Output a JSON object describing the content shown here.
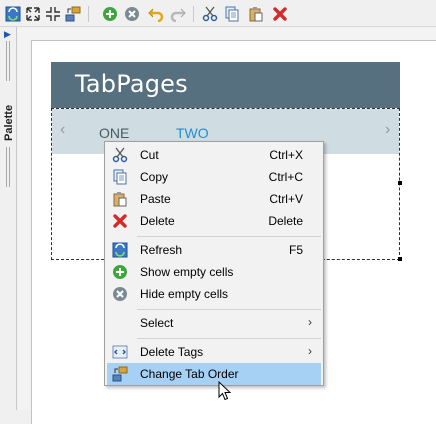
{
  "toolbar": {
    "buttons": [
      {
        "name": "refresh-icon"
      },
      {
        "name": "expand-icon"
      },
      {
        "name": "collapse-icon"
      },
      {
        "name": "change-tab-order-icon"
      },
      {
        "name": "show-empty-cells-icon"
      },
      {
        "name": "hide-empty-cells-icon"
      },
      {
        "name": "undo-icon"
      },
      {
        "name": "redo-icon"
      },
      {
        "name": "cut-icon"
      },
      {
        "name": "copy-icon"
      },
      {
        "name": "paste-icon"
      },
      {
        "name": "delete-icon"
      }
    ]
  },
  "palette": {
    "label": "Palette"
  },
  "widget": {
    "title": "TabPages",
    "tabs": [
      "ONE",
      "TWO"
    ],
    "active_tab": "TWO",
    "prev_arrow": "‹",
    "next_arrow": "›"
  },
  "context_menu": {
    "items": [
      {
        "label": "Cut",
        "shortcut": "Ctrl+X",
        "icon": "cut-icon"
      },
      {
        "label": "Copy",
        "shortcut": "Ctrl+C",
        "icon": "copy-icon"
      },
      {
        "label": "Paste",
        "shortcut": "Ctrl+V",
        "icon": "paste-icon"
      },
      {
        "label": "Delete",
        "shortcut": "Delete",
        "icon": "delete-icon"
      },
      {
        "label": "Refresh",
        "shortcut": "F5",
        "icon": "refresh-icon"
      },
      {
        "label": "Show empty cells",
        "icon": "show-empty-cells-icon"
      },
      {
        "label": "Hide empty cells",
        "icon": "hide-empty-cells-icon"
      },
      {
        "label": "Select",
        "submenu": "›"
      },
      {
        "label": "Delete Tags",
        "submenu": "›",
        "icon": "delete-tags-icon"
      },
      {
        "label": "Change Tab Order",
        "icon": "change-tab-order-icon",
        "selected": true
      }
    ]
  },
  "colors": {
    "header_bg": "#56707f",
    "tabs_bg": "#cfdde3",
    "active_tab": "#1f8fd0",
    "inactive_tab": "#4a5a63",
    "menu_highlight": "#a6d1f4"
  }
}
